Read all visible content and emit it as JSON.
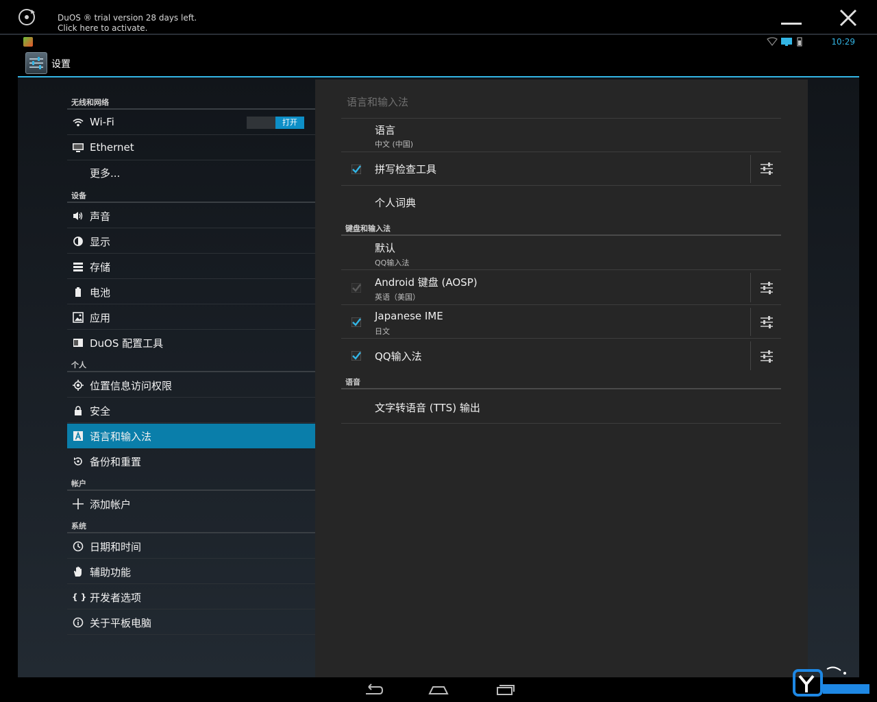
{
  "duos_bar": {
    "trial_text": "DuOS ® trial version 28 days left.",
    "activate_text": "Click here to activate."
  },
  "status_bar": {
    "time": "10:29",
    "accent": "#33b5e5"
  },
  "action_bar": {
    "title": "设置",
    "icon": "settings-app-icon"
  },
  "left": {
    "categories": {
      "wireless": "无线和网络",
      "device": "设备",
      "personal": "个人",
      "accounts": "帐户",
      "system": "系统"
    },
    "items": {
      "wifi": {
        "label": "Wi-Fi",
        "toggle": "打开",
        "icon": "wifi-icon"
      },
      "ethernet": {
        "label": "Ethernet",
        "icon": "ethernet-icon"
      },
      "more": {
        "label": "更多..."
      },
      "sound": {
        "label": "声音",
        "icon": "sound-icon"
      },
      "display": {
        "label": "显示",
        "icon": "display-icon"
      },
      "storage": {
        "label": "存储",
        "icon": "storage-icon"
      },
      "battery": {
        "label": "电池",
        "icon": "battery-icon"
      },
      "apps": {
        "label": "应用",
        "icon": "apps-icon"
      },
      "duos_config": {
        "label": "DuOS 配置工具",
        "icon": "duos-config-icon"
      },
      "location": {
        "label": "位置信息访问权限",
        "icon": "location-icon"
      },
      "security": {
        "label": "安全",
        "icon": "lock-icon"
      },
      "language": {
        "label": "语言和输入法",
        "icon": "language-icon",
        "selected": true
      },
      "backup": {
        "label": "备份和重置",
        "icon": "backup-icon"
      },
      "add_account": {
        "label": "添加帐户",
        "icon": "plus-icon"
      },
      "datetime": {
        "label": "日期和时间",
        "icon": "clock-icon"
      },
      "accessibility": {
        "label": "辅助功能",
        "icon": "hand-icon"
      },
      "developer": {
        "label": "开发者选项",
        "icon_text": "{ }"
      },
      "about": {
        "label": "关于平板电脑",
        "icon": "info-icon"
      }
    },
    "selected_color": "#0a7eaa"
  },
  "right": {
    "title": "语言和输入法",
    "language": {
      "title": "语言",
      "summary": "中文 (中国)"
    },
    "spell": {
      "title": "拼写检查工具",
      "checked": true
    },
    "dictionary": {
      "title": "个人词典"
    },
    "keyboard_category": "键盘和输入法",
    "default": {
      "title": "默认",
      "summary": "QQ输入法"
    },
    "aosp": {
      "title": "Android 键盘 (AOSP)",
      "summary": "英语（美国）",
      "checked": true,
      "disabled": true
    },
    "japanese": {
      "title": "Japanese IME",
      "summary": "日文",
      "checked": true
    },
    "qq": {
      "title": "QQ输入法",
      "checked": true
    },
    "speech_category": "语音",
    "tts": {
      "title": "文字转语音 (TTS) 输出"
    }
  }
}
